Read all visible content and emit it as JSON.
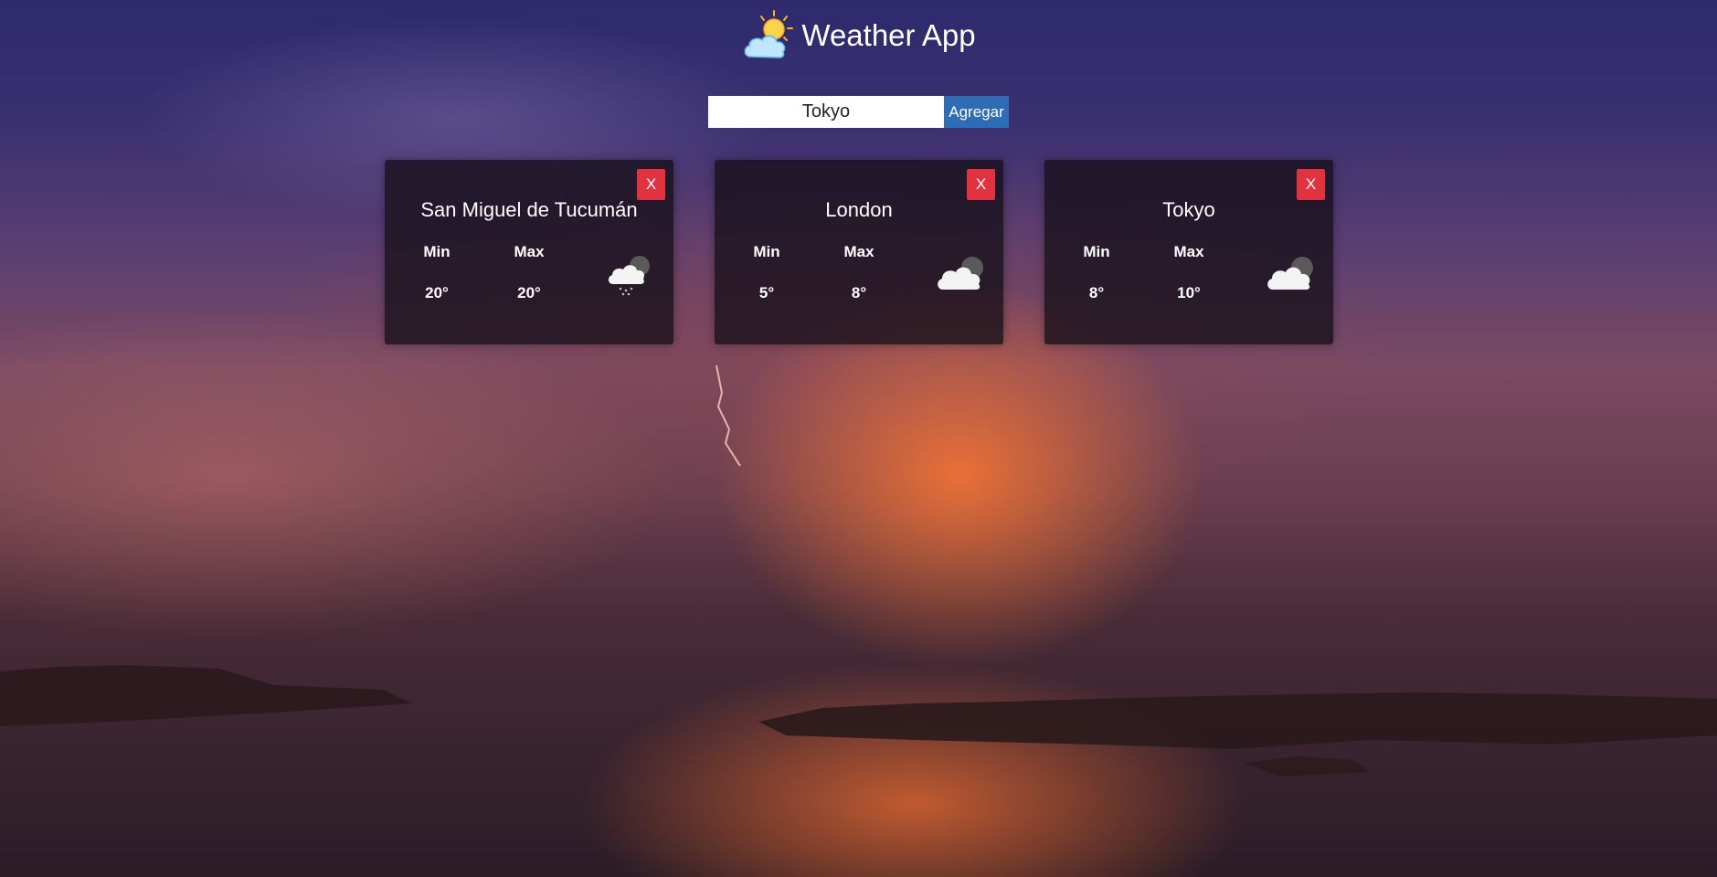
{
  "header": {
    "title": "Weather App",
    "logo_icon": "sun-behind-cloud-icon"
  },
  "search": {
    "value": "Tokyo",
    "button_label": "Agregar"
  },
  "cards": [
    {
      "city": "San Miguel de Tucumán",
      "min_label": "Min",
      "max_label": "Max",
      "min": "20°",
      "max": "20°",
      "icon": "rain-cloud-night-icon",
      "close_label": "X"
    },
    {
      "city": "London",
      "min_label": "Min",
      "max_label": "Max",
      "min": "5°",
      "max": "8°",
      "icon": "cloud-night-icon",
      "close_label": "X"
    },
    {
      "city": "Tokyo",
      "min_label": "Min",
      "max_label": "Max",
      "min": "8°",
      "max": "10°",
      "icon": "cloud-night-icon",
      "close_label": "X"
    }
  ],
  "colors": {
    "accent_button": "#2f6cb6",
    "close_button": "#e0323f",
    "card_background": "rgba(22,16,24,0.78)"
  }
}
